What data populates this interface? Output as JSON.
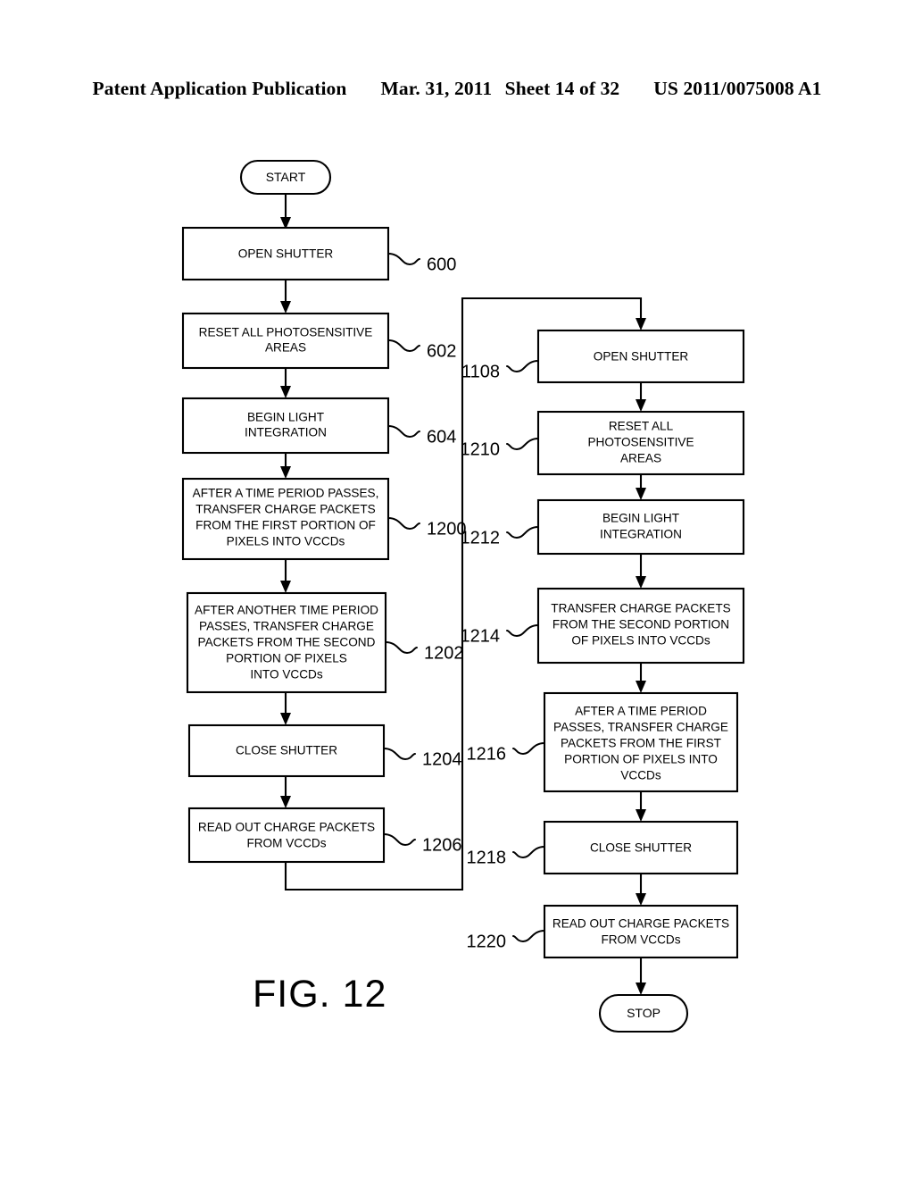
{
  "header": {
    "publication": "Patent Application Publication",
    "date": "Mar. 31, 2011",
    "sheet": "Sheet 14 of 32",
    "doc_number": "US 2011/0075008 A1"
  },
  "figure": {
    "caption": "FIG. 12"
  },
  "flowchart": {
    "left_column": {
      "start": {
        "label": "START",
        "shape": "pill"
      },
      "steps": [
        {
          "ref": "600",
          "lines": [
            "OPEN SHUTTER"
          ]
        },
        {
          "ref": "602",
          "lines": [
            "RESET ALL PHOTOSENSITIVE",
            "AREAS"
          ]
        },
        {
          "ref": "604",
          "lines": [
            "BEGIN LIGHT",
            "INTEGRATION"
          ]
        },
        {
          "ref": "1200",
          "lines": [
            "AFTER A TIME PERIOD PASSES,",
            "TRANSFER CHARGE PACKETS",
            "FROM THE FIRST PORTION OF",
            "PIXELS INTO VCCDs"
          ]
        },
        {
          "ref": "1202",
          "lines": [
            "AFTER ANOTHER TIME PERIOD",
            "PASSES, TRANSFER CHARGE",
            "PACKETS FROM THE SECOND",
            "PORTION OF PIXELS",
            "INTO VCCDs"
          ]
        },
        {
          "ref": "1204",
          "lines": [
            "CLOSE SHUTTER"
          ]
        },
        {
          "ref": "1206",
          "lines": [
            "READ OUT CHARGE PACKETS",
            "FROM VCCDs"
          ]
        }
      ]
    },
    "right_column": {
      "steps": [
        {
          "ref": "1108",
          "lines": [
            "OPEN SHUTTER"
          ]
        },
        {
          "ref": "1210",
          "lines": [
            "RESET ALL",
            "PHOTOSENSITIVE",
            "AREAS"
          ]
        },
        {
          "ref": "1212",
          "lines": [
            "BEGIN LIGHT",
            "INTEGRATION"
          ]
        },
        {
          "ref": "1214",
          "lines": [
            "TRANSFER CHARGE PACKETS",
            "FROM THE SECOND PORTION",
            "OF PIXELS INTO VCCDs"
          ]
        },
        {
          "ref": "1216",
          "lines": [
            "AFTER A TIME PERIOD",
            "PASSES, TRANSFER CHARGE",
            "PACKETS FROM THE FIRST",
            "PORTION OF PIXELS INTO",
            "VCCDs"
          ]
        },
        {
          "ref": "1218",
          "lines": [
            "CLOSE SHUTTER"
          ]
        },
        {
          "ref": "1220",
          "lines": [
            "READ OUT CHARGE PACKETS",
            "FROM VCCDs"
          ]
        }
      ],
      "stop": {
        "label": "STOP",
        "shape": "pill"
      }
    }
  },
  "colors": {
    "ink": "#000000",
    "paper": "#ffffff"
  }
}
